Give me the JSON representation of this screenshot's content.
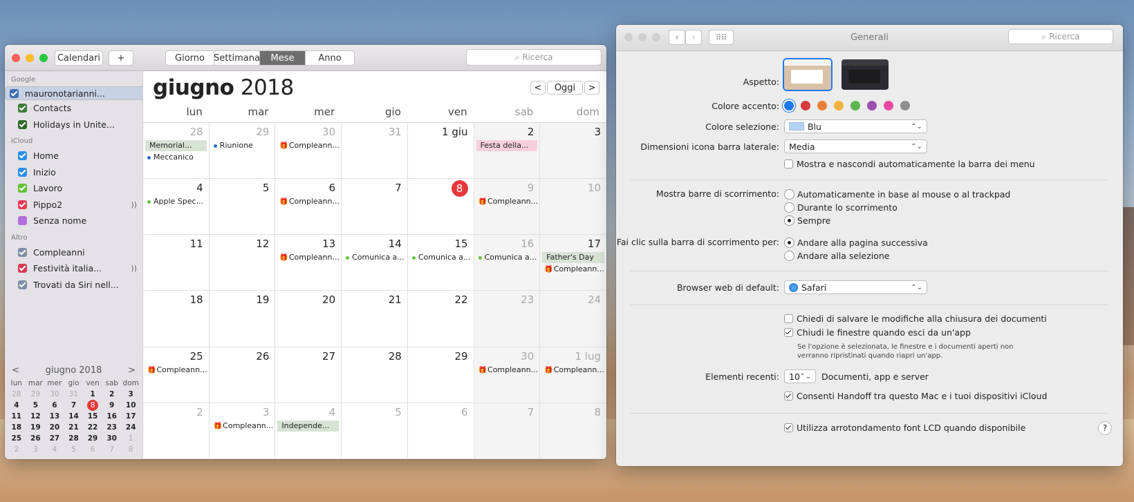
{
  "calendar": {
    "toolbar": {
      "calendars_label": "Calendari",
      "add_label": "+",
      "views": [
        "Giorno",
        "Settimana",
        "Mese",
        "Anno"
      ],
      "active_view": "Mese",
      "search_placeholder": "Ricerca"
    },
    "sidebar": {
      "groups": [
        {
          "name": "Google",
          "items": [
            {
              "label": "mauronotarianni...",
              "color": "#3f6fb4",
              "selected": true
            },
            {
              "label": "Contacts",
              "color": "#3d7a3b"
            },
            {
              "label": "Holidays in Unite...",
              "color": "#2f6a2d"
            }
          ]
        },
        {
          "name": "iCloud",
          "items": [
            {
              "label": "Home",
              "color": "#2c8ee8"
            },
            {
              "label": "Inizio",
              "color": "#2c8ee8"
            },
            {
              "label": "Lavoro",
              "color": "#63c13a"
            },
            {
              "label": "Pippo2",
              "color": "#e63b57",
              "shared": true
            },
            {
              "label": "Senza nome",
              "color": "#b36fdb",
              "unchecked": true
            }
          ]
        },
        {
          "name": "Altro",
          "items": [
            {
              "label": "Compleanni",
              "color": "#7f8ea8"
            },
            {
              "label": "Festività italia...",
              "color": "#d63b55",
              "shared": true
            },
            {
              "label": "Trovati da Siri nell...",
              "color": "#7f8ea8"
            }
          ]
        }
      ]
    },
    "mini": {
      "title": "giugno 2018",
      "prev": "<",
      "next": ">",
      "dow": [
        "lun",
        "mar",
        "mer",
        "gio",
        "ven",
        "sab",
        "dom"
      ],
      "days": [
        "28",
        "29",
        "30",
        "31",
        "1",
        "2",
        "3",
        "4",
        "5",
        "6",
        "7",
        "8",
        "9",
        "10",
        "11",
        "12",
        "13",
        "14",
        "15",
        "16",
        "17",
        "18",
        "19",
        "20",
        "21",
        "22",
        "23",
        "24",
        "25",
        "26",
        "27",
        "28",
        "29",
        "30",
        "1",
        "2",
        "3",
        "4",
        "5",
        "6",
        "7",
        "8"
      ]
    },
    "header": {
      "month": "giugno",
      "year": "2018",
      "prev": "<",
      "today": "Oggi",
      "next": ">"
    },
    "dow": [
      "lun",
      "mar",
      "mer",
      "gio",
      "ven",
      "sab",
      "dom"
    ],
    "cells": [
      {
        "d": "28",
        "dim": true,
        "ev": [
          {
            "t": "Memorial...",
            "k": "block",
            "c": "#d7e3d4"
          },
          {
            "t": "Meccanico",
            "k": "dot",
            "c": "#2c6fc9"
          }
        ]
      },
      {
        "d": "29",
        "dim": true,
        "ev": [
          {
            "t": "Riunione",
            "k": "dot",
            "c": "#2c6fc9"
          }
        ]
      },
      {
        "d": "30",
        "dim": true,
        "ev": [
          {
            "t": "Compleann...",
            "k": "gift"
          }
        ]
      },
      {
        "d": "31",
        "dim": true,
        "ev": []
      },
      {
        "d": "1 giu",
        "ev": []
      },
      {
        "d": "2",
        "ev": [
          {
            "t": "Festa della...",
            "k": "block",
            "c": "#f7cfdc"
          }
        ]
      },
      {
        "d": "3",
        "ev": []
      },
      {
        "d": "4",
        "ev": [
          {
            "t": "Apple Spec...",
            "k": "dot",
            "c": "#63c13a"
          }
        ]
      },
      {
        "d": "5",
        "ev": []
      },
      {
        "d": "6",
        "ev": [
          {
            "t": "Compleann...",
            "k": "gift"
          }
        ]
      },
      {
        "d": "7",
        "ev": []
      },
      {
        "d": "8",
        "today": true,
        "ev": []
      },
      {
        "d": "9",
        "dim": true,
        "ev": [
          {
            "t": "Compleann...",
            "k": "gift"
          }
        ]
      },
      {
        "d": "10",
        "dim": true,
        "ev": []
      },
      {
        "d": "11",
        "ev": []
      },
      {
        "d": "12",
        "ev": []
      },
      {
        "d": "13",
        "ev": [
          {
            "t": "Compleann...",
            "k": "gift"
          }
        ]
      },
      {
        "d": "14",
        "ev": [
          {
            "t": "Comunica a...",
            "k": "dot",
            "c": "#63c13a"
          }
        ]
      },
      {
        "d": "15",
        "ev": [
          {
            "t": "Comunica a...",
            "k": "dot",
            "c": "#63c13a"
          }
        ]
      },
      {
        "d": "16",
        "dim": true,
        "ev": [
          {
            "t": "Comunica a...",
            "k": "dot",
            "c": "#63c13a"
          }
        ]
      },
      {
        "d": "17",
        "ev": [
          {
            "t": "Father's Day",
            "k": "block",
            "c": "#d7e3d4"
          },
          {
            "t": "Compleann...",
            "k": "gift"
          }
        ]
      },
      {
        "d": "18",
        "ev": []
      },
      {
        "d": "19",
        "ev": []
      },
      {
        "d": "20",
        "ev": []
      },
      {
        "d": "21",
        "ev": []
      },
      {
        "d": "22",
        "ev": []
      },
      {
        "d": "23",
        "dim": true,
        "ev": []
      },
      {
        "d": "24",
        "dim": true,
        "ev": []
      },
      {
        "d": "25",
        "ev": [
          {
            "t": "Compleann...",
            "k": "gift"
          }
        ]
      },
      {
        "d": "26",
        "ev": []
      },
      {
        "d": "27",
        "ev": []
      },
      {
        "d": "28",
        "ev": []
      },
      {
        "d": "29",
        "ev": []
      },
      {
        "d": "30",
        "dim": true,
        "ev": [
          {
            "t": "Compleann...",
            "k": "gift"
          }
        ]
      },
      {
        "d": "1 lug",
        "dim": true,
        "ev": [
          {
            "t": "Compleann...",
            "k": "gift"
          }
        ]
      },
      {
        "d": "2",
        "dim": true,
        "ev": []
      },
      {
        "d": "3",
        "dim": true,
        "ev": [
          {
            "t": "Compleann...",
            "k": "gift"
          }
        ]
      },
      {
        "d": "4",
        "dim": true,
        "ev": [
          {
            "t": "Independe...",
            "k": "block",
            "c": "#d7e3d4"
          }
        ]
      },
      {
        "d": "5",
        "dim": true,
        "ev": []
      },
      {
        "d": "6",
        "dim": true,
        "ev": []
      },
      {
        "d": "7",
        "dim": true,
        "ev": []
      },
      {
        "d": "8",
        "dim": true,
        "ev": []
      }
    ]
  },
  "prefs": {
    "title": "Generali",
    "search_placeholder": "Ricerca",
    "aspetto_label": "Aspetto:",
    "accent_label": "Colore accento:",
    "accent_colors": [
      "#1d79f0",
      "#d63a3e",
      "#e8813a",
      "#f2b33c",
      "#5eb44f",
      "#9b4fb0",
      "#e74aa0",
      "#8e8e8e"
    ],
    "selection_label": "Colore selezione:",
    "selection_value": "Blu",
    "sidebar_label": "Dimensioni icona barra laterale:",
    "sidebar_value": "Media",
    "autohide_label": "Mostra e nascondi automaticamente la barra dei menu",
    "scroll_label": "Mostra barre di scorrimento:",
    "scroll_options": [
      "Automaticamente in base al mouse o al trackpad",
      "Durante lo scorrimento",
      "Sempre"
    ],
    "click_label": "Fai clic sulla barra di scorrimento per:",
    "click_options": [
      "Andare alla pagina successiva",
      "Andare alla selezione"
    ],
    "browser_label": "Browser web di default:",
    "browser_value": "Safari",
    "ask_save_label": "Chiedi di salvare le modifiche alla chiusura dei documenti",
    "close_windows_label": "Chiudi le finestre quando esci da un'app",
    "close_windows_note1": "Se l'opzione è selezionata, le finestre e i documenti aperti non",
    "close_windows_note2": "verranno ripristinati quando riapri un'app.",
    "recent_label": "Elementi recenti:",
    "recent_value": "10",
    "recent_suffix": "Documenti, app e server",
    "handoff_label": "Consenti Handoff tra questo Mac e i tuoi dispositivi iCloud",
    "lcd_label": "Utilizza arrotondamento font LCD quando disponibile",
    "help": "?"
  }
}
